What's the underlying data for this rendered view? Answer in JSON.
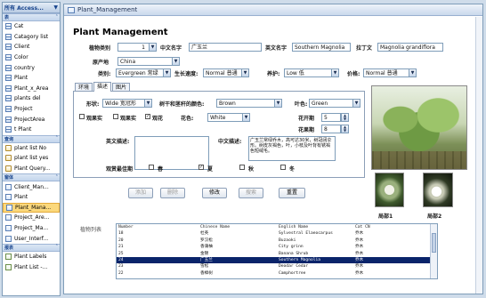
{
  "nav": {
    "header": "所有 Access...",
    "groups": {
      "tables": "表",
      "queries": "查询",
      "forms": "窗体",
      "reports": "报表"
    },
    "tables": [
      "Cat",
      "Catagory list",
      "Client",
      "Color",
      "country",
      "Plant",
      "Plant_x_Area",
      "plants del",
      "Project",
      "ProjectArea",
      "t Plant"
    ],
    "queries": [
      "plant list No",
      "plant list yes",
      "Plant Query..."
    ],
    "forms": [
      "Client_Man...",
      "Plant",
      "Plant_Mana...",
      "Project_Are...",
      "Project_Ma...",
      "User_Interf..."
    ],
    "reports": [
      "Plant Labels",
      "Plant List -..."
    ]
  },
  "window": {
    "title": "Plant_Management"
  },
  "form": {
    "heading": "Plant Management",
    "labels": {
      "category": "植物类别",
      "chinese_name": "中文名字",
      "english_name": "英文名字",
      "latin_name": "拉丁文",
      "origin": "原产地",
      "type": "类别:",
      "growth_speed": "生长速度:",
      "maintenance": "养护:",
      "price": "价格:",
      "shape": "形状:",
      "flower_fruit_color": "树干和茎秆的颜色:",
      "leaf_color": "叶色:",
      "fruit": "观果实",
      "fruit2": "观果实",
      "flower": "观花",
      "flower_color": "花色:",
      "flowering": "花开期",
      "fruit_period": "花果期",
      "english_desc": "英文描述:",
      "chinese_desc": "中文描述:",
      "best_season": "观赏最佳期",
      "spring": "春",
      "summer": "夏",
      "autumn": "秋",
      "winter": "冬"
    },
    "values": {
      "category": "1",
      "chinese_name": "广玉兰",
      "english_name": "Southern Magnolia",
      "latin_name": "Magnolia grandiflora",
      "origin": "China",
      "type": "Evergreen 常绿",
      "growth_speed": "Normal 普通",
      "maintenance": "Low 低",
      "price": "Normal 普通",
      "shape": "Wide 宽冠形",
      "flower_fruit_color": "Brown",
      "leaf_color": "Green",
      "flower_color": "White",
      "flowering": "5",
      "fruit_period": "8",
      "english_desc": "",
      "chinese_desc": "广玉兰常绿乔木，高可达30米，树冠阔伞形。树皮灰褐色，叶，小枝及叶背有锈褐色短绒毛。"
    },
    "checks": {
      "fruit": false,
      "fruit2": false,
      "flower": true,
      "spring": false,
      "summer": true,
      "autumn": false,
      "winter": false
    },
    "tabs": [
      "环境",
      "描述",
      "图片"
    ],
    "active_tab": "描述",
    "picture_captions": [
      "局部1",
      "局部2"
    ],
    "buttons": {
      "add": "添加",
      "delete": "删除",
      "edit": "修改",
      "search": "搜索",
      "reset": "重置"
    },
    "buttons_disabled": [
      "add",
      "delete",
      "search"
    ],
    "list_label": "植物列表"
  },
  "plant_list": {
    "columns": [
      "Number",
      "Chinese Name",
      "English Name",
      "Cat CN"
    ],
    "rows": [
      [
        "18",
        "杜英",
        "Sylvestral Elaeocarpus",
        "乔木"
      ],
      [
        "20",
        "罗汉松",
        "Buzaoki",
        "乔木"
      ],
      [
        "21",
        "香蒲柚",
        "City grinn",
        "乔木"
      ],
      [
        "25",
        "金锦",
        "Banana Shrub",
        "乔木"
      ],
      [
        "24",
        "广玉兰",
        "Southern Magnolia",
        "乔木"
      ],
      [
        "23",
        "雪松",
        "Deodar Cedar",
        "乔木"
      ],
      [
        "22",
        "香樟树",
        "Camphortree",
        "乔木"
      ]
    ],
    "selected_index": 4
  }
}
